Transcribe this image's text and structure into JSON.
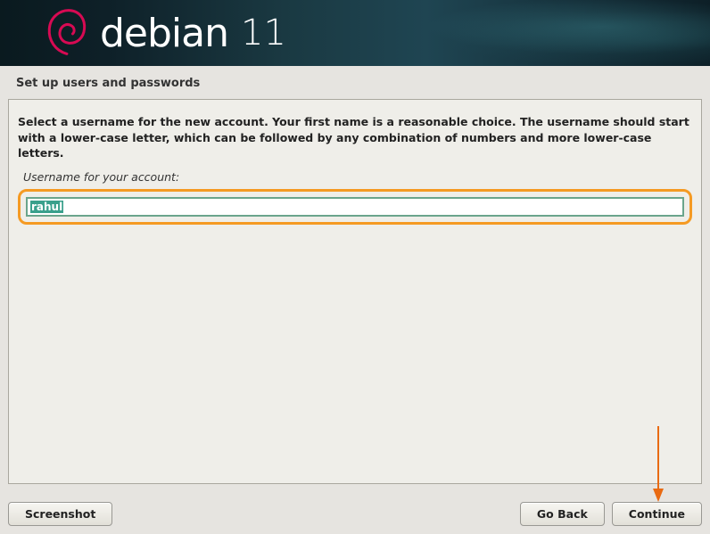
{
  "header": {
    "brand": "debian",
    "version": "11"
  },
  "page": {
    "title": "Set up users and passwords",
    "instruction": "Select a username for the new account. Your first name is a reasonable choice. The username should start with a lower-case letter, which can be followed by any combination of numbers and more lower-case letters.",
    "field_label": "Username for your account:",
    "username_value": "rahul"
  },
  "buttons": {
    "screenshot": "Screenshot",
    "go_back": "Go Back",
    "continue": "Continue"
  }
}
